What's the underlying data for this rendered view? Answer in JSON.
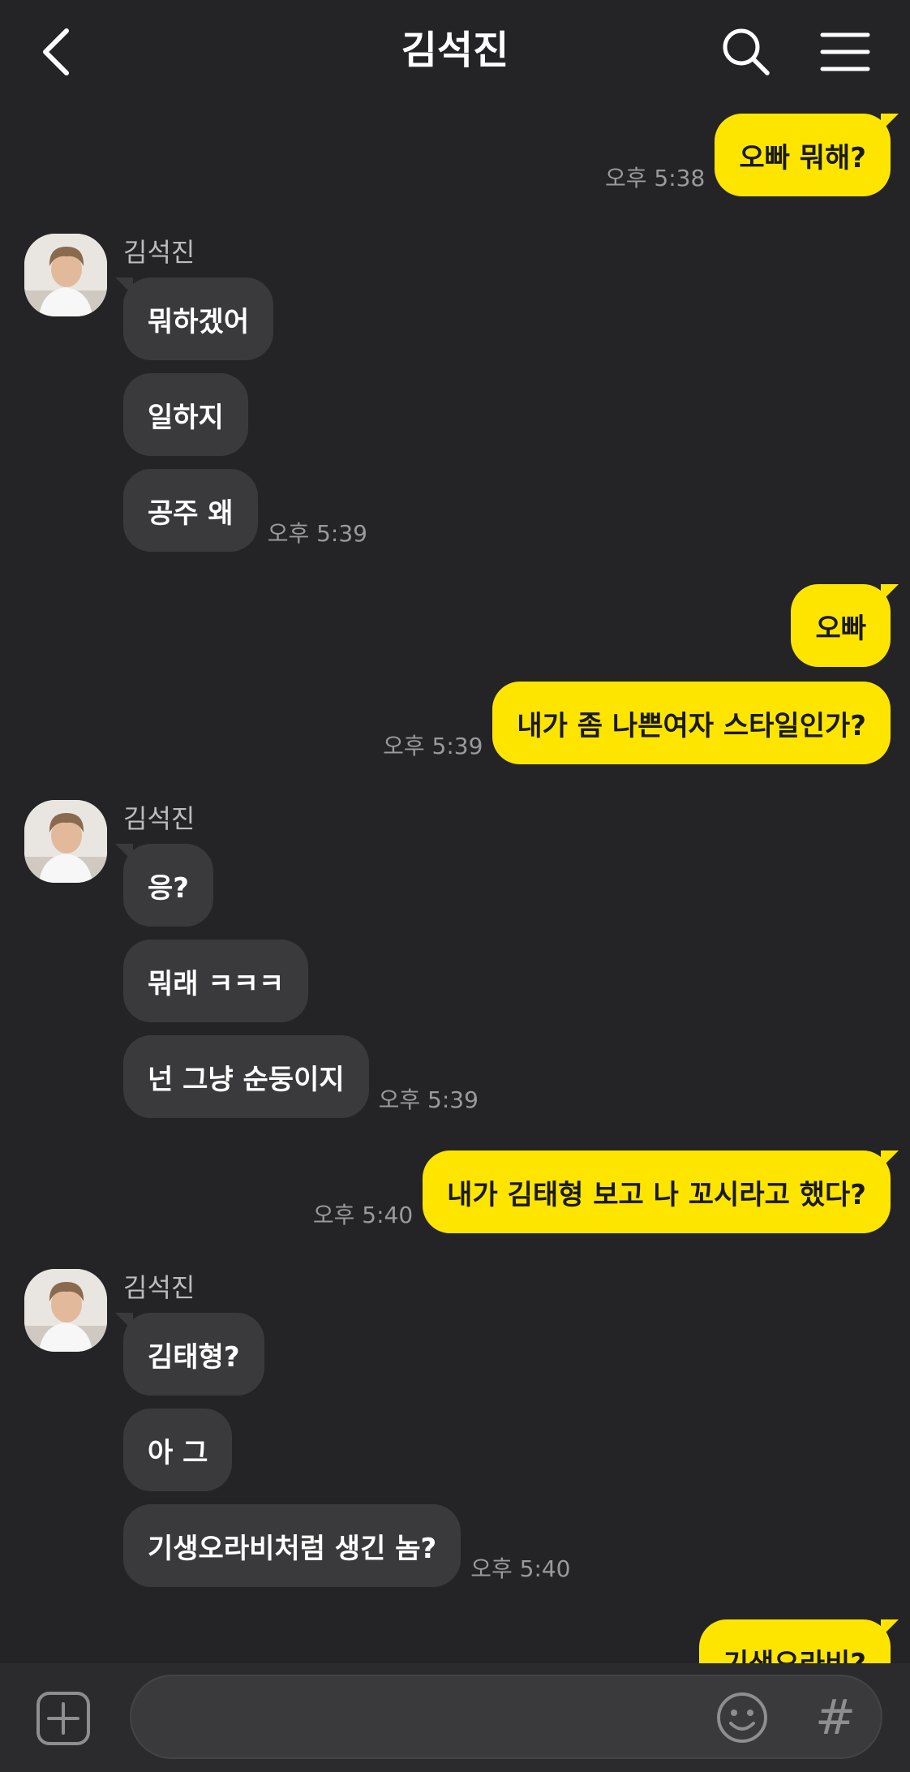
{
  "header": {
    "title": "김석진"
  },
  "chat": {
    "sender_name": "김석진",
    "messages": [
      {
        "text": "오빠 뭐해?",
        "time": "오후 5:38"
      },
      {
        "text": "뭐하겠어"
      },
      {
        "text": "일하지"
      },
      {
        "text": "공주 왜",
        "time": "오후 5:39"
      },
      {
        "text": "오빠"
      },
      {
        "text": "내가 좀 나쁜여자 스타일인가?",
        "time": "오후 5:39"
      },
      {
        "text": "응?"
      },
      {
        "text": "뭐래 ㅋㅋㅋ"
      },
      {
        "text": "넌 그냥 순둥이지",
        "time": "오후 5:39"
      },
      {
        "text": "내가 김태형 보고 나 꼬시라고 했다?",
        "time": "오후 5:40"
      },
      {
        "text": "김태형?"
      },
      {
        "text": "아 그"
      },
      {
        "text": "기생오라비처럼 생긴 놈?",
        "time": "오후 5:40"
      },
      {
        "text": "기생오라비?"
      }
    ]
  },
  "input": {
    "placeholder": "",
    "value": ""
  },
  "icons": {
    "back": "chevron-left-icon",
    "search": "search-icon",
    "menu": "hamburger-menu-icon",
    "attach": "plus-square-icon",
    "emoji": "smiley-icon",
    "hashtag": "#"
  },
  "colors": {
    "background": "#242427",
    "my_bubble": "#fee500",
    "their_bubble": "#3a3a3c",
    "timestamp": "#9a9a9d"
  }
}
